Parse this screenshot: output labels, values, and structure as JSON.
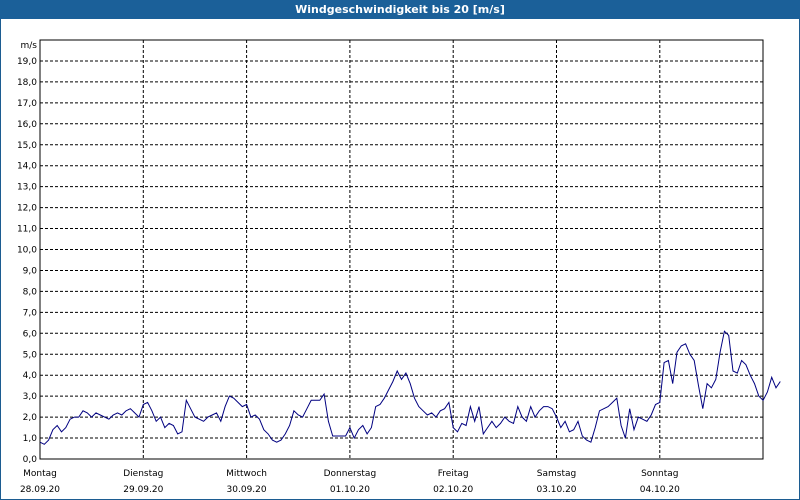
{
  "window": {
    "title": "Windgeschwindigkeit bis 20 [m/s]"
  },
  "colors": {
    "titlebar": "#1b6099",
    "series": "#000080",
    "grid": "#000000"
  },
  "chart_data": {
    "type": "line",
    "title": "Windgeschwindigkeit bis 20 [m/s]",
    "ylabel": "m/s",
    "ylim": [
      0,
      20
    ],
    "yticks": [
      "0,0",
      "1,0",
      "2,0",
      "3,0",
      "4,0",
      "5,0",
      "6,0",
      "7,0",
      "8,0",
      "9,0",
      "10,0",
      "11,0",
      "12,0",
      "13,0",
      "14,0",
      "15,0",
      "16,0",
      "17,0",
      "18,0",
      "19,0"
    ],
    "x_categories": [
      {
        "day": "Montag",
        "date": "28.09.20"
      },
      {
        "day": "Dienstag",
        "date": "29.09.20"
      },
      {
        "day": "Mittwoch",
        "date": "30.09.20"
      },
      {
        "day": "Donnerstag",
        "date": "01.10.20"
      },
      {
        "day": "Freitag",
        "date": "02.10.20"
      },
      {
        "day": "Samstag",
        "date": "03.10.20"
      },
      {
        "day": "Sonntag",
        "date": "04.10.20"
      }
    ],
    "grid": true,
    "series": [
      {
        "points_per_day": 24,
        "values": [
          0.8,
          0.7,
          0.9,
          1.4,
          1.6,
          1.3,
          1.5,
          1.9,
          2.0,
          2.0,
          2.3,
          2.2,
          2.0,
          2.2,
          2.1,
          2.0,
          1.9,
          2.1,
          2.2,
          2.1,
          2.3,
          2.4,
          2.2,
          2.0,
          2.6,
          2.7,
          2.3,
          1.8,
          2.0,
          1.5,
          1.7,
          1.6,
          1.2,
          1.3,
          2.8,
          2.4,
          2.0,
          1.9,
          1.8,
          2.0,
          2.1,
          2.2,
          1.8,
          2.5,
          3.0,
          2.9,
          2.7,
          2.5,
          2.6,
          2.0,
          2.1,
          1.9,
          1.4,
          1.2,
          0.9,
          0.8,
          0.9,
          1.2,
          1.6,
          2.3,
          2.1,
          2.0,
          2.4,
          2.8,
          2.8,
          2.8,
          3.1,
          1.8,
          1.1,
          1.1,
          1.1,
          1.1,
          1.5,
          1.0,
          1.4,
          1.6,
          1.2,
          1.5,
          2.5,
          2.6,
          2.9,
          3.3,
          3.7,
          4.2,
          3.8,
          4.1,
          3.6,
          2.9,
          2.5,
          2.3,
          2.1,
          2.2,
          2.0,
          2.3,
          2.4,
          2.7,
          1.5,
          1.3,
          1.7,
          1.6,
          2.5,
          1.8,
          2.5,
          1.2,
          1.5,
          1.8,
          1.5,
          1.7,
          2.0,
          1.8,
          1.7,
          2.5,
          2.0,
          1.8,
          2.5,
          2.0,
          2.3,
          2.5,
          2.5,
          2.4,
          2.0,
          1.5,
          1.8,
          1.3,
          1.4,
          1.8,
          1.1,
          0.9,
          0.8,
          1.5,
          2.3,
          2.4,
          2.5,
          2.7,
          2.9,
          1.6,
          1.0,
          2.4,
          1.4,
          2.0,
          1.9,
          1.8,
          2.1,
          2.6,
          2.7,
          4.6,
          4.7,
          3.6,
          5.1,
          5.4,
          5.5,
          5.0,
          4.7,
          3.5,
          2.4,
          3.6,
          3.4,
          3.8,
          5.1,
          6.1,
          5.9,
          4.2,
          4.1,
          4.7,
          4.5,
          4.0,
          3.6,
          3.0,
          2.8,
          3.2,
          3.9,
          3.4,
          3.7
        ]
      }
    ]
  }
}
